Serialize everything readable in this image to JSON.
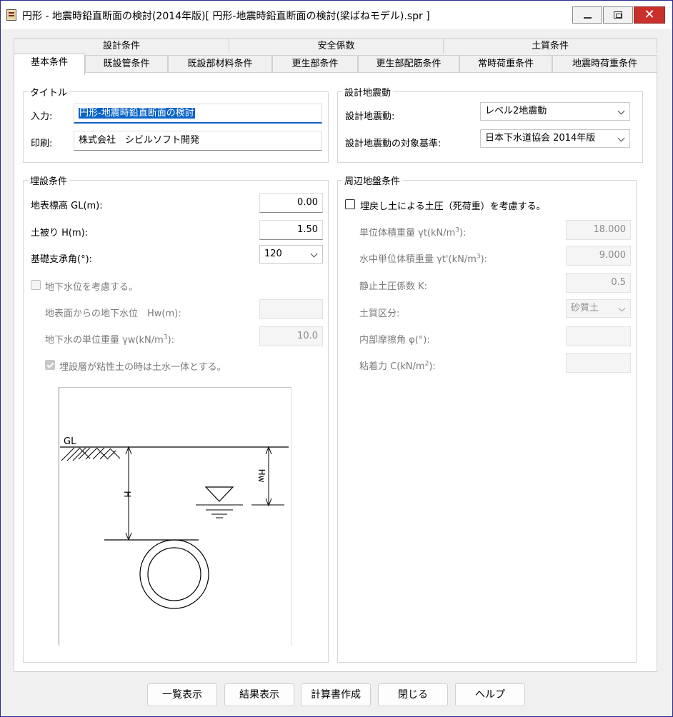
{
  "window": {
    "title": "円形 - 地震時鉛直断面の検討(2014年版)[ 円形-地震時鉛直断面の検討(梁ばねモデル).spr ]"
  },
  "tabs": {
    "row1": [
      "設計条件",
      "安全係数",
      "土質条件"
    ],
    "row2": [
      "基本条件",
      "既設管条件",
      "既設部材料条件",
      "更生部条件",
      "更生部配筋条件",
      "常時荷重条件",
      "地震時荷重条件"
    ],
    "active": "基本条件"
  },
  "title_group": {
    "heading": "タイトル",
    "input_label": "入力:",
    "input_value": "円形-地震時鉛直断面の検討",
    "print_label": "印刷:",
    "print_value": "株式会社　シビルソフト開発"
  },
  "seismic_group": {
    "heading": "設計地震動",
    "motion_label": "設計地震動:",
    "motion_value": "レベル2地震動",
    "standard_label": "設計地震動の対象基準:",
    "standard_value": "日本下水道協会 2014年版"
  },
  "burial_group": {
    "heading": "埋設条件",
    "gl_label": "地表標高 GL(m):",
    "gl_value": "0.00",
    "cover_label": "土被り H(m):",
    "cover_value": "1.50",
    "angle_label": "基礎支承角(°):",
    "angle_value": "120",
    "gw_check_label": "地下水位を考慮する。",
    "gw_check_checked": false,
    "gw_depth_label": "地表面からの地下水位　Hw(m):",
    "gw_depth_value": "",
    "gw_weight_label_main": "地下水の単位重量 γw(kN/m",
    "gw_weight_label_sup": "3",
    "gw_weight_label_end": "):",
    "gw_weight_value": "10.0",
    "clay_check_label": "埋設層が粘性土の時は土水一体とする。",
    "clay_check_checked": true
  },
  "diagram": {
    "gl_label": "GL",
    "h_label": "H",
    "hw_label": "Hw"
  },
  "ground_group": {
    "heading": "周辺地盤条件",
    "backfill_check_label": "埋戻し土による土圧（死荷重）を考慮する。",
    "backfill_check_checked": false,
    "unit_weight_label_main": "単位体積重量 γt(kN/m",
    "unit_weight_label_sup": "3",
    "unit_weight_label_end": "):",
    "unit_weight_value": "18.000",
    "sub_weight_label_main": "水中単位体積重量 γt'(kN/m",
    "sub_weight_label_sup": "3",
    "sub_weight_label_end": "):",
    "sub_weight_value": "9.000",
    "k_label": "静止土圧係数 K:",
    "k_value": "0.5",
    "soil_type_label": "土質区分:",
    "soil_type_value": "砂質土",
    "friction_label": "内部摩擦角 φ(°):",
    "friction_value": "",
    "cohesion_label_main": "粘着力 C(kN/m",
    "cohesion_label_sup": "2",
    "cohesion_label_end": "):",
    "cohesion_value": ""
  },
  "buttons": {
    "list": "一覧表示",
    "result": "結果表示",
    "report": "計算書作成",
    "close": "閉じる",
    "help": "ヘルプ"
  },
  "colors": {
    "selection": "#0a64c8",
    "close_button": "#c9302c",
    "focus_underline": "#1060c0"
  }
}
